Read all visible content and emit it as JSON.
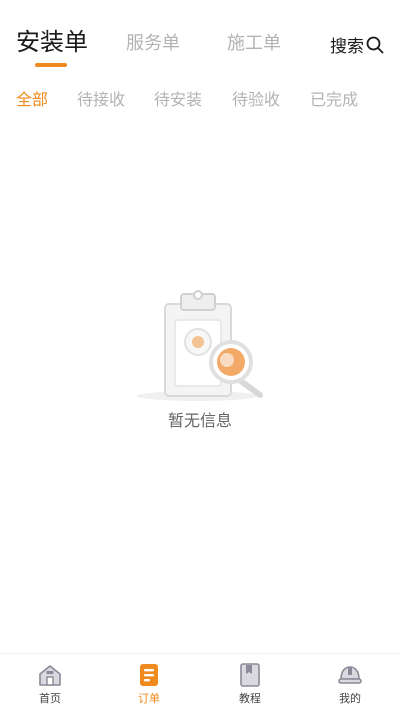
{
  "top_tabs": [
    {
      "label": "安装单",
      "active": true
    },
    {
      "label": "服务单",
      "active": false
    },
    {
      "label": "施工单",
      "active": false
    }
  ],
  "search": {
    "label": "搜索",
    "icon": "search-icon"
  },
  "filters": [
    {
      "label": "全部",
      "active": true
    },
    {
      "label": "待接收",
      "active": false
    },
    {
      "label": "待安装",
      "active": false
    },
    {
      "label": "待验收",
      "active": false
    },
    {
      "label": "已完成",
      "active": false
    }
  ],
  "empty_state": {
    "text": "暂无信息",
    "icon": "clipboard-search-icon"
  },
  "bottom_nav": [
    {
      "label": "首页",
      "icon": "home-icon",
      "active": false
    },
    {
      "label": "订单",
      "icon": "order-icon",
      "active": true
    },
    {
      "label": "教程",
      "icon": "tutorial-icon",
      "active": false
    },
    {
      "label": "我的",
      "icon": "helmet-icon",
      "active": false
    }
  ],
  "colors": {
    "accent": "#f08a1c",
    "inactive": "#b3b3b3",
    "text": "#1a1a1a"
  }
}
